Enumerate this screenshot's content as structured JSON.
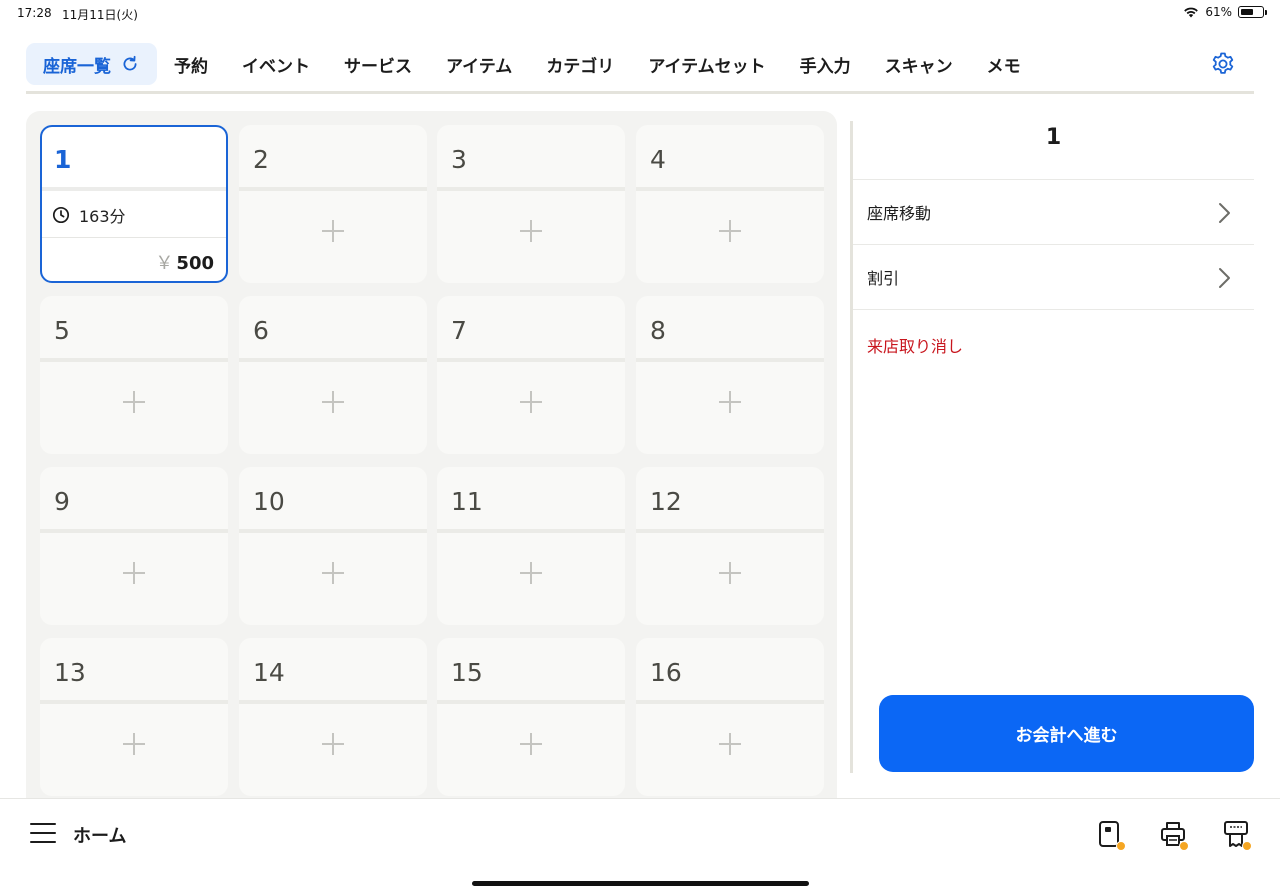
{
  "status_bar": {
    "time": "17:28",
    "date": "11月11日(火)",
    "battery": "61%",
    "battery_level": 0.61
  },
  "tabs": {
    "active_label": "座席一覧",
    "items": [
      "予約",
      "イベント",
      "サービス",
      "アイテム",
      "カテゴリ",
      "アイテムセット",
      "手入力",
      "スキャン",
      "メモ"
    ]
  },
  "seats": [
    {
      "number": "1",
      "active": true,
      "elapsed": "163分",
      "currency": "￥",
      "amount": "500"
    },
    {
      "number": "2"
    },
    {
      "number": "3"
    },
    {
      "number": "4"
    },
    {
      "number": "5"
    },
    {
      "number": "6"
    },
    {
      "number": "7"
    },
    {
      "number": "8"
    },
    {
      "number": "9"
    },
    {
      "number": "10"
    },
    {
      "number": "11"
    },
    {
      "number": "12"
    },
    {
      "number": "13"
    },
    {
      "number": "14"
    },
    {
      "number": "15"
    },
    {
      "number": "16"
    }
  ],
  "side_panel": {
    "seat_number": "1",
    "move_seat": "座席移動",
    "discount": "割引",
    "cancel_visit": "来店取り消し",
    "checkout_button": "お会計へ進む"
  },
  "bottom_bar": {
    "home_label": "ホーム"
  },
  "colors": {
    "accent": "#1a64d6",
    "checkout": "#0b67f5",
    "danger": "#c8161e",
    "badge": "#f5a623"
  },
  "icons": [
    "wifi-icon",
    "battery-icon",
    "refresh-icon",
    "gear-icon",
    "clock-icon",
    "chevron-right-icon",
    "hamburger-menu-icon",
    "card-reader-icon",
    "printer-icon",
    "receipt-printer-icon"
  ]
}
